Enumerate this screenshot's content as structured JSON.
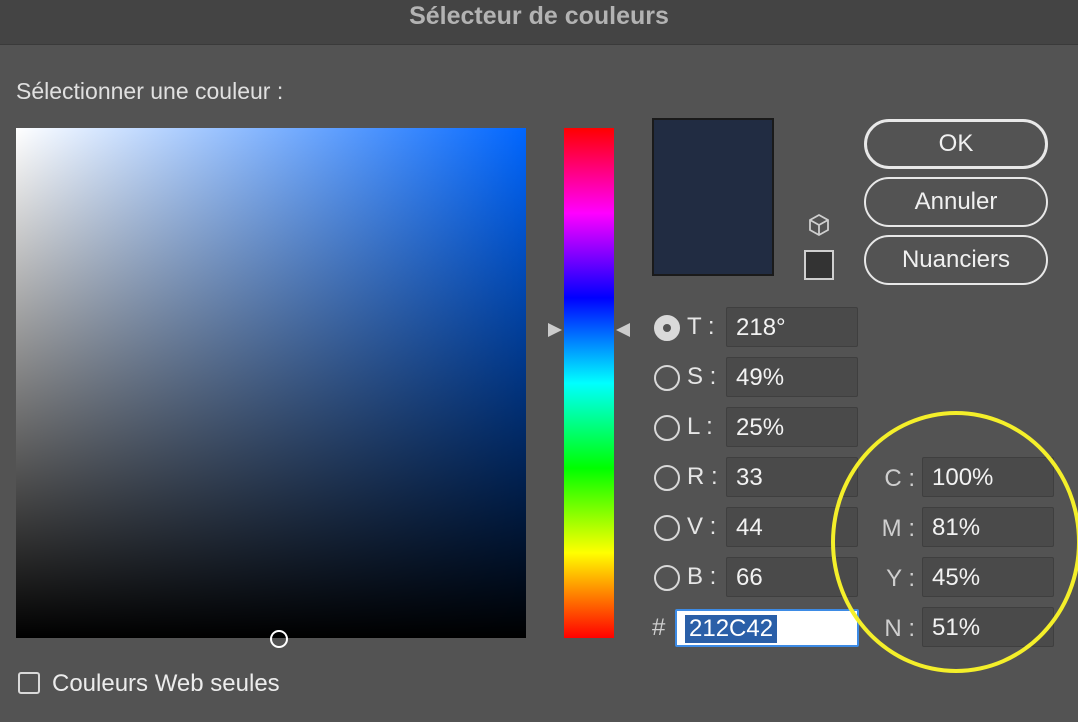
{
  "window": {
    "title": "Sélecteur de couleurs"
  },
  "picker": {
    "select_label": "Sélectionner une couleur :",
    "current_color": "#212C42"
  },
  "buttons": {
    "ok": "OK",
    "cancel": "Annuler",
    "swatches": "Nuanciers"
  },
  "hsb": [
    {
      "label": "T :",
      "value": "218°",
      "selected": true
    },
    {
      "label": "S :",
      "value": "49%",
      "selected": false
    },
    {
      "label": "L :",
      "value": "25%",
      "selected": false
    }
  ],
  "rgb": [
    {
      "label": "R :",
      "value": "33",
      "selected": false
    },
    {
      "label": "V :",
      "value": "44",
      "selected": false
    },
    {
      "label": "B :",
      "value": "66",
      "selected": false
    }
  ],
  "cmyk": [
    {
      "label": "C :",
      "value": "100%"
    },
    {
      "label": "M :",
      "value": "81%"
    },
    {
      "label": "Y :",
      "value": "45%"
    },
    {
      "label": "N :",
      "value": "51%"
    }
  ],
  "hex": {
    "label": "#",
    "value": "212C42"
  },
  "web_only": {
    "label": "Couleurs Web seules",
    "checked": false
  },
  "colors": {
    "highlight": "#f4ef2a",
    "selection": "#2a5fa8",
    "focus": "#3d8be5"
  },
  "icons": [
    "gamut-cube-icon",
    "web-safe-swatch"
  ]
}
